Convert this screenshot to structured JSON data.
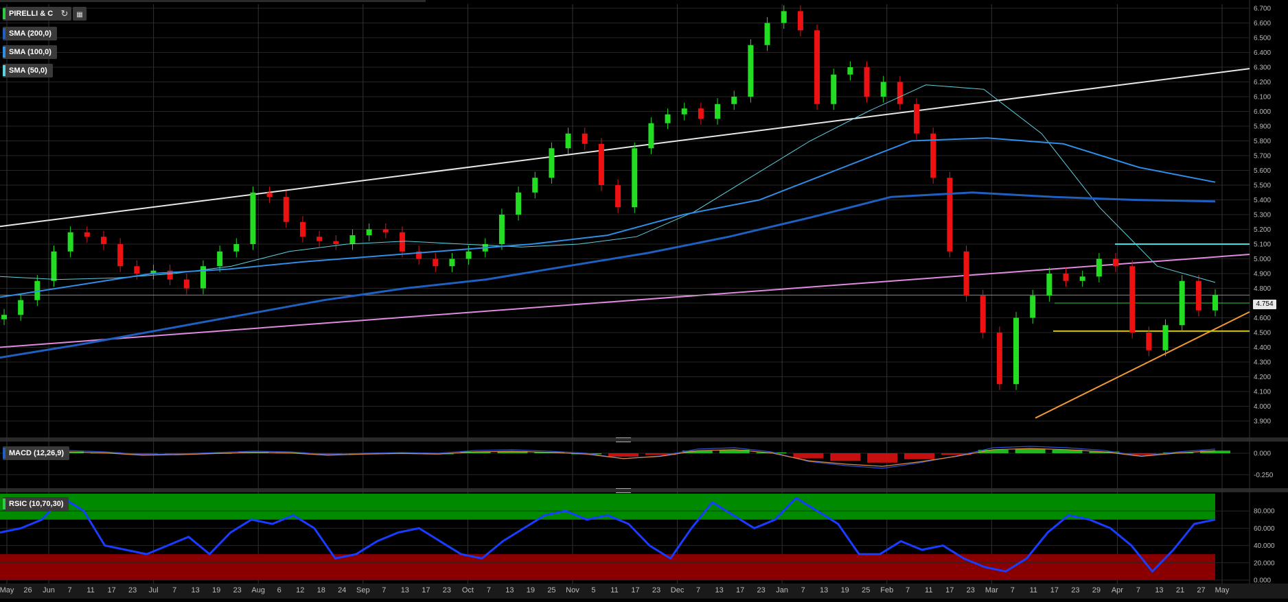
{
  "header": {
    "symbol": "PIRELLI & C",
    "refresh_icon": "refresh-icon",
    "settings_icon": "chart-settings-icon"
  },
  "indicators": {
    "sma200": {
      "label": "SMA (200,0)",
      "color": "#1f5fbf"
    },
    "sma100": {
      "label": "SMA (100,0)",
      "color": "#2f8ee8"
    },
    "sma50": {
      "label": "SMA (50,0)",
      "color": "#5fd0e0"
    },
    "macd": {
      "label": "MACD (12,26,9)",
      "color": "#1f5fbf"
    },
    "rsic": {
      "label": "RSIC (10,70,30)",
      "color": "#2ecc40"
    }
  },
  "last_price": "4.754",
  "chart_data": [
    {
      "type": "candlestick",
      "title": "PIRELLI & C",
      "ylim": [
        3.9,
        6.7
      ],
      "y_ticks": [
        "6.700",
        "6.600",
        "6.500",
        "6.400",
        "6.300",
        "6.200",
        "6.100",
        "6.000",
        "5.900",
        "5.800",
        "5.700",
        "5.600",
        "5.500",
        "5.400",
        "5.300",
        "5.200",
        "5.100",
        "5.000",
        "4.900",
        "4.800",
        "4.700",
        "4.600",
        "4.500",
        "4.400",
        "4.300",
        "4.200",
        "4.100",
        "4.000",
        "3.900"
      ],
      "x_ticks": [
        "May",
        "26",
        "Jun",
        "7",
        "11",
        "17",
        "23",
        "Jul",
        "7",
        "13",
        "19",
        "23",
        "Aug",
        "6",
        "12",
        "18",
        "24",
        "Sep",
        "7",
        "13",
        "17",
        "23",
        "Oct",
        "7",
        "13",
        "19",
        "25",
        "Nov",
        "5",
        "11",
        "17",
        "23",
        "Dec",
        "7",
        "13",
        "17",
        "23",
        "Jan",
        "7",
        "13",
        "19",
        "25",
        "Feb",
        "7",
        "11",
        "17",
        "23",
        "Mar",
        "7",
        "11",
        "17",
        "23",
        "29",
        "Apr",
        "7",
        "13",
        "21",
        "27",
        "May"
      ],
      "close_series": [
        4.62,
        4.72,
        4.85,
        5.05,
        5.18,
        5.15,
        5.1,
        4.95,
        4.9,
        4.92,
        4.86,
        4.8,
        4.95,
        5.05,
        5.1,
        5.45,
        5.42,
        5.25,
        5.15,
        5.12,
        5.1,
        5.16,
        5.2,
        5.18,
        5.05,
        5.0,
        4.95,
        5.0,
        5.05,
        5.1,
        5.3,
        5.45,
        5.55,
        5.75,
        5.85,
        5.78,
        5.5,
        5.35,
        5.75,
        5.92,
        5.98,
        6.02,
        5.95,
        6.05,
        6.1,
        6.45,
        6.6,
        6.68,
        6.55,
        6.05,
        6.25,
        6.3,
        6.1,
        6.2,
        6.05,
        5.85,
        5.55,
        5.05,
        4.75,
        4.5,
        4.15,
        4.6,
        4.75,
        4.9,
        4.85,
        4.88,
        5.0,
        4.95,
        4.5,
        4.38,
        4.55,
        4.85,
        4.65,
        4.754
      ],
      "series": [
        {
          "name": "SMA (50,0)",
          "values": [
            4.88,
            4.86,
            4.87,
            4.9,
            4.95,
            5.05,
            5.1,
            5.12,
            5.1,
            5.08,
            5.1,
            5.15,
            5.32,
            5.56,
            5.8,
            6.0,
            6.18,
            6.15,
            5.85,
            5.35,
            4.95,
            4.84
          ]
        },
        {
          "name": "SMA (100,0)",
          "values": [
            4.74,
            4.82,
            4.9,
            4.93,
            4.98,
            5.02,
            5.06,
            5.1,
            5.16,
            5.3,
            5.4,
            5.6,
            5.8,
            5.82,
            5.78,
            5.62,
            5.52
          ]
        },
        {
          "name": "SMA (200,0)",
          "values": [
            4.33,
            4.42,
            4.52,
            4.62,
            4.72,
            4.8,
            4.86,
            4.95,
            5.04,
            5.15,
            5.28,
            5.42,
            5.45,
            5.42,
            5.4,
            5.39
          ]
        }
      ]
    },
    {
      "type": "bar",
      "title": "MACD (12,26,9)",
      "y_ticks": [
        "0.000",
        "-0.250"
      ],
      "ylim": [
        -0.36,
        0.12
      ],
      "histogram": [
        0.02,
        0.01,
        -0.01,
        -0.005,
        0.005,
        0.015,
        0.01,
        -0.01,
        0.0,
        0.005,
        0.0,
        0.02,
        0.025,
        0.015,
        0.0,
        -0.04,
        -0.02,
        0.03,
        0.04,
        0.01,
        -0.06,
        -0.09,
        -0.11,
        -0.07,
        -0.02,
        0.04,
        0.05,
        0.04,
        0.02,
        -0.02,
        0.01,
        0.03
      ]
    },
    {
      "type": "line",
      "title": "RSIC (10,70,30)",
      "y_ticks": [
        "80.000",
        "60.000",
        "40.000",
        "20.000",
        "0.000"
      ],
      "ylim": [
        0,
        100
      ],
      "upper": 70,
      "lower": 30,
      "series": [
        {
          "name": "RSIC (10,70,30)",
          "values": [
            55,
            60,
            70,
            95,
            80,
            40,
            35,
            30,
            40,
            50,
            30,
            55,
            70,
            65,
            75,
            60,
            25,
            30,
            45,
            55,
            60,
            45,
            30,
            25,
            45,
            60,
            75,
            80,
            70,
            75,
            65,
            40,
            25,
            60,
            90,
            75,
            60,
            70,
            95,
            80,
            65,
            30,
            30,
            45,
            35,
            40,
            25,
            15,
            10,
            25,
            55,
            75,
            70,
            60,
            40,
            10,
            35,
            65,
            70
          ]
        }
      ]
    }
  ]
}
